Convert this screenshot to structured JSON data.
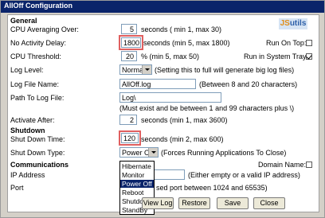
{
  "window": {
    "title": "AllOff Configuration"
  },
  "logo": {
    "prefix": "JS",
    "rest": "utils"
  },
  "general": {
    "header": "General",
    "cpu_avg": {
      "label": "CPU Averaging Over:",
      "value": "5",
      "hint": "seconds ( min 1, max 30)"
    },
    "no_activity": {
      "label": "No Activity Delay:",
      "value": "1800",
      "hint": "seconds (min 5, max 1800)"
    },
    "run_on_top": {
      "label": "Run On Top:",
      "checked": false
    },
    "cpu_threshold": {
      "label": "CPU Threshold:",
      "value": "20",
      "hint": "% (min 5, max 50)"
    },
    "run_in_tray": {
      "label": "Run in System Tray:",
      "checked": true
    },
    "log_level": {
      "label": "Log Level:",
      "value": "Normal",
      "hint": "(Setting this to full will generate big log files)"
    },
    "log_file_name": {
      "label": "Log File Name:",
      "value": "AllOff.log",
      "hint": "(Between 8 and 20 characters)"
    },
    "path_to_log": {
      "label": "Path To Log File:",
      "value": "Log\\",
      "hint": "(Must exist and be between 1 and 99 characters plus \\)"
    },
    "activate_after": {
      "label": "Activate After:",
      "value": "2",
      "hint": "seconds (min 1, max 3600)"
    }
  },
  "shutdown": {
    "header": "Shutdown",
    "time": {
      "label": "Shut Down Time:",
      "value": "120",
      "hint": "seconds (min 2, max 600)"
    },
    "type": {
      "label": "Shut Down Type:",
      "value": "Power Off",
      "hint": "(Forces Running Applications To Close)"
    },
    "type_options": [
      "Hibernate",
      "Monitor",
      "Power Off",
      "Reboot",
      "Shutdown",
      "StandBy"
    ],
    "type_selected": "Power Off"
  },
  "communications": {
    "header": "Communications",
    "domain": {
      "label": "Domain Name:",
      "checked": false
    },
    "ip": {
      "label": "IP Address",
      "hint": "(Either empty or a valid IP address)"
    },
    "port": {
      "label": "Port",
      "hint": "sed port between 1024 and 65535)"
    }
  },
  "buttons": {
    "view_log": "View Log",
    "restore": "Restore",
    "save": "Save",
    "close": "Close"
  }
}
